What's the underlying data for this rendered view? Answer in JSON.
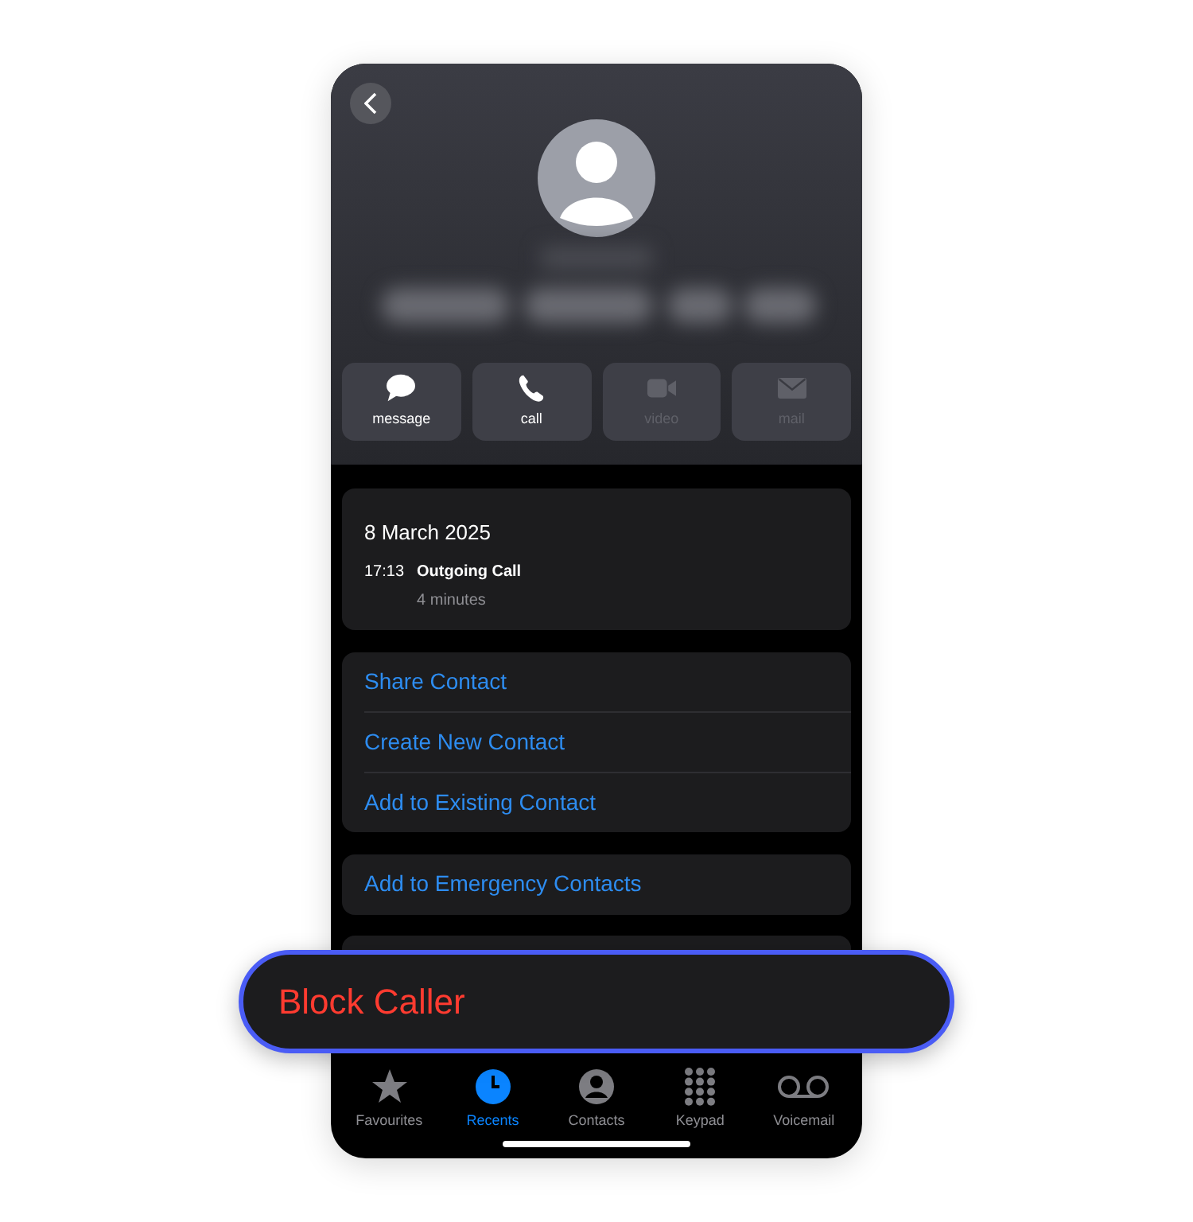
{
  "actions": [
    {
      "label": "message",
      "kind": "message",
      "disabled": false
    },
    {
      "label": "call",
      "kind": "call",
      "disabled": false
    },
    {
      "label": "video",
      "kind": "video",
      "disabled": true
    },
    {
      "label": "mail",
      "kind": "mail",
      "disabled": true
    }
  ],
  "call_log": {
    "date": "8 March 2025",
    "time": "17:13",
    "type": "Outgoing Call",
    "duration": "4 minutes"
  },
  "contact_actions": [
    "Share Contact",
    "Create New Contact",
    "Add to Existing Contact"
  ],
  "emergency_action": "Add to Emergency Contacts",
  "highlight": {
    "label": "Block Caller"
  },
  "tabs": [
    {
      "label": "Favourites",
      "kind": "star",
      "selected": false
    },
    {
      "label": "Recents",
      "kind": "clock",
      "selected": true
    },
    {
      "label": "Contacts",
      "kind": "person",
      "selected": false
    },
    {
      "label": "Keypad",
      "kind": "keypad",
      "selected": false
    },
    {
      "label": "Voicemail",
      "kind": "voicemail",
      "selected": false
    }
  ]
}
